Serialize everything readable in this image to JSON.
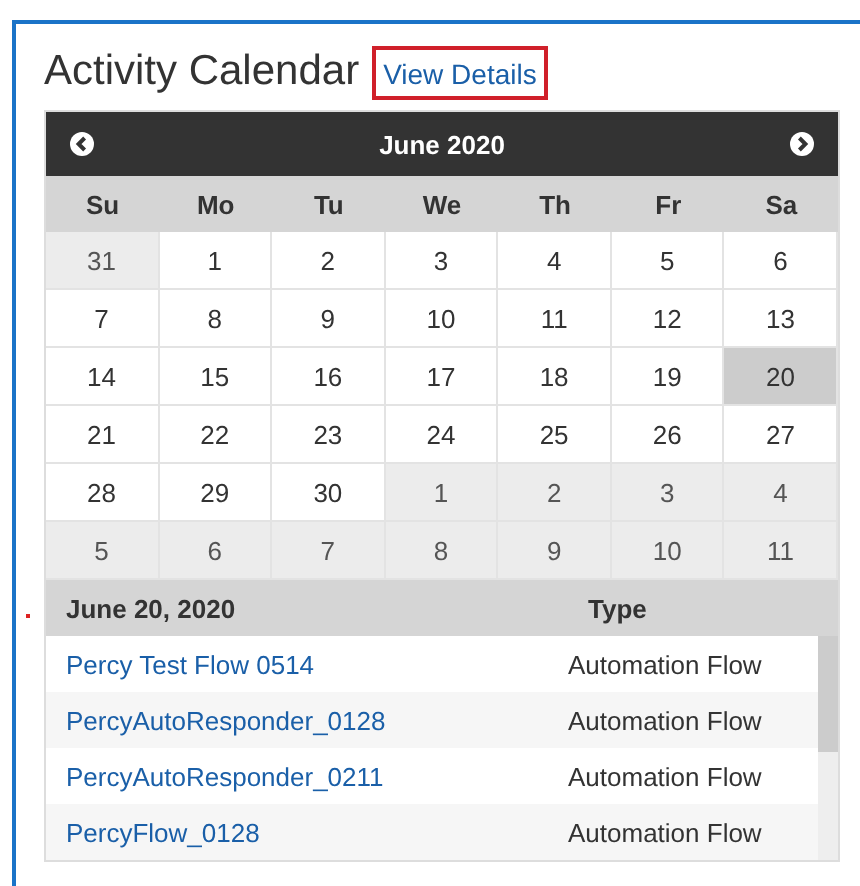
{
  "title": "Activity Calendar",
  "view_details": "View Details",
  "calendar": {
    "month": "June 2020",
    "weekdays": [
      "Su",
      "Mo",
      "Tu",
      "We",
      "Th",
      "Fr",
      "Sa"
    ],
    "weeks": [
      [
        {
          "label": "31",
          "other_month": true,
          "selected": false
        },
        {
          "label": "1",
          "other_month": false,
          "selected": false
        },
        {
          "label": "2",
          "other_month": false,
          "selected": false
        },
        {
          "label": "3",
          "other_month": false,
          "selected": false
        },
        {
          "label": "4",
          "other_month": false,
          "selected": false
        },
        {
          "label": "5",
          "other_month": false,
          "selected": false
        },
        {
          "label": "6",
          "other_month": false,
          "selected": false
        }
      ],
      [
        {
          "label": "7",
          "other_month": false,
          "selected": false
        },
        {
          "label": "8",
          "other_month": false,
          "selected": false
        },
        {
          "label": "9",
          "other_month": false,
          "selected": false
        },
        {
          "label": "10",
          "other_month": false,
          "selected": false
        },
        {
          "label": "11",
          "other_month": false,
          "selected": false
        },
        {
          "label": "12",
          "other_month": false,
          "selected": false
        },
        {
          "label": "13",
          "other_month": false,
          "selected": false
        }
      ],
      [
        {
          "label": "14",
          "other_month": false,
          "selected": false
        },
        {
          "label": "15",
          "other_month": false,
          "selected": false
        },
        {
          "label": "16",
          "other_month": false,
          "selected": false
        },
        {
          "label": "17",
          "other_month": false,
          "selected": false
        },
        {
          "label": "18",
          "other_month": false,
          "selected": false
        },
        {
          "label": "19",
          "other_month": false,
          "selected": false
        },
        {
          "label": "20",
          "other_month": false,
          "selected": true
        }
      ],
      [
        {
          "label": "21",
          "other_month": false,
          "selected": false
        },
        {
          "label": "22",
          "other_month": false,
          "selected": false
        },
        {
          "label": "23",
          "other_month": false,
          "selected": false
        },
        {
          "label": "24",
          "other_month": false,
          "selected": false
        },
        {
          "label": "25",
          "other_month": false,
          "selected": false
        },
        {
          "label": "26",
          "other_month": false,
          "selected": false
        },
        {
          "label": "27",
          "other_month": false,
          "selected": false
        }
      ],
      [
        {
          "label": "28",
          "other_month": false,
          "selected": false
        },
        {
          "label": "29",
          "other_month": false,
          "selected": false
        },
        {
          "label": "30",
          "other_month": false,
          "selected": false
        },
        {
          "label": "1",
          "other_month": true,
          "selected": false
        },
        {
          "label": "2",
          "other_month": true,
          "selected": false
        },
        {
          "label": "3",
          "other_month": true,
          "selected": false
        },
        {
          "label": "4",
          "other_month": true,
          "selected": false
        }
      ],
      [
        {
          "label": "5",
          "other_month": true,
          "selected": false
        },
        {
          "label": "6",
          "other_month": true,
          "selected": false
        },
        {
          "label": "7",
          "other_month": true,
          "selected": false
        },
        {
          "label": "8",
          "other_month": true,
          "selected": false
        },
        {
          "label": "9",
          "other_month": true,
          "selected": false
        },
        {
          "label": "10",
          "other_month": true,
          "selected": false
        },
        {
          "label": "11",
          "other_month": true,
          "selected": false
        }
      ]
    ]
  },
  "activities": {
    "columns": [
      "June 20, 2020",
      "Type"
    ],
    "rows": [
      {
        "name": "Percy Test Flow 0514",
        "type": "Automation Flow"
      },
      {
        "name": "PercyAutoResponder_0128",
        "type": "Automation Flow"
      },
      {
        "name": "PercyAutoResponder_0211",
        "type": "Automation Flow"
      },
      {
        "name": "PercyFlow_0128",
        "type": "Automation Flow"
      }
    ]
  }
}
